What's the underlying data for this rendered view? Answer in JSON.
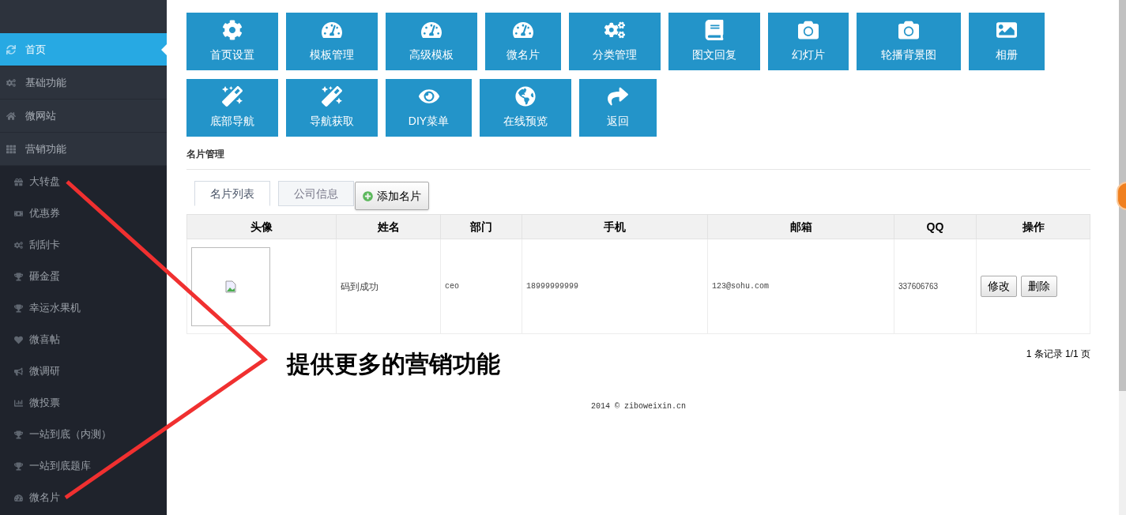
{
  "sidebar": {
    "items": [
      {
        "label": "首页",
        "selected": true
      },
      {
        "label": "基础功能",
        "selected": false
      },
      {
        "label": "微网站",
        "selected": false
      },
      {
        "label": "营销功能",
        "selected": false,
        "children": [
          {
            "label": "大转盘"
          },
          {
            "label": "优惠券"
          },
          {
            "label": "刮刮卡"
          },
          {
            "label": "砸金蛋"
          },
          {
            "label": "幸运水果机"
          },
          {
            "label": "微喜帖"
          },
          {
            "label": "微调研"
          },
          {
            "label": "微投票"
          },
          {
            "label": "一站到底（内测）"
          },
          {
            "label": "一站到底题库"
          },
          {
            "label": "微名片"
          }
        ]
      }
    ]
  },
  "tiles": [
    [
      {
        "label": "首页设置"
      },
      {
        "label": "模板管理"
      },
      {
        "label": "高级模板"
      },
      {
        "label": "微名片"
      },
      {
        "label": "分类管理"
      },
      {
        "label": "图文回复"
      },
      {
        "label": "幻灯片"
      },
      {
        "label": "轮播背景图"
      },
      {
        "label": "相册"
      }
    ],
    [
      {
        "label": "底部导航"
      },
      {
        "label": "导航获取"
      },
      {
        "label": "DIY菜单"
      },
      {
        "label": "在线预览"
      },
      {
        "label": "返回"
      }
    ]
  ],
  "section_title": "名片管理",
  "tabs": [
    {
      "label": "名片列表",
      "selected": true
    },
    {
      "label": "公司信息",
      "selected": false
    }
  ],
  "add_button": "添加名片",
  "table": {
    "columns": [
      "头像",
      "姓名",
      "部门",
      "手机",
      "邮箱",
      "QQ",
      "操作"
    ],
    "rows": [
      {
        "name": "码到成功",
        "department": "ceo",
        "phone": "18999999999",
        "email": "123@sohu.com",
        "qq": "337606763",
        "actions": [
          "修改",
          "删除"
        ]
      }
    ]
  },
  "pagination": "1 条记录 1/1 页",
  "annotation": "提供更多的营销功能",
  "footer": "2014 © ziboweixin.cn"
}
